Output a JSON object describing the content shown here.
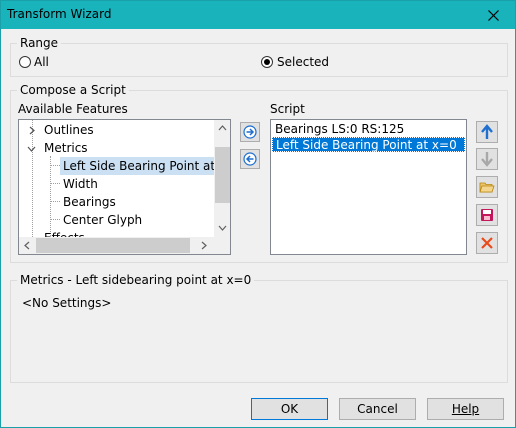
{
  "window": {
    "title": "Transform Wizard"
  },
  "range": {
    "label": "Range",
    "options": [
      {
        "label": "All",
        "selected": false
      },
      {
        "label": "Selected",
        "selected": true
      }
    ]
  },
  "compose": {
    "label": "Compose a Script",
    "available_label": "Available Features",
    "tree": [
      {
        "label": "Outlines",
        "expander": "collapsed"
      },
      {
        "label": "Metrics",
        "expander": "expanded"
      },
      {
        "label": "Left Side Bearing Point at x=",
        "selected": true
      },
      {
        "label": "Width"
      },
      {
        "label": "Bearings"
      },
      {
        "label": "Center Glyph"
      },
      {
        "label": "Effects"
      }
    ],
    "script_label": "Script",
    "script_items": [
      {
        "label": "Bearings LS:0 RS:125",
        "selected": false
      },
      {
        "label": "Left Side Bearing Point at x=0",
        "selected": true
      }
    ],
    "icons": {
      "add": "arrow-right-circle-icon",
      "remove": "arrow-left-circle-icon",
      "move_up": "arrow-up-icon",
      "move_down": "arrow-down-icon",
      "open": "open-folder-icon",
      "save": "save-icon",
      "delete": "delete-x-icon"
    }
  },
  "settings": {
    "label": "Metrics - Left sidebearing point at x=0",
    "value": "<No Settings>"
  },
  "buttons": {
    "ok": "OK",
    "cancel": "Cancel",
    "help": "Help"
  },
  "colors": {
    "titlebar": "#19b3bc",
    "selection": "#0078d7",
    "tree_selection": "#cce0f4",
    "arrow_blue": "#1e6fd0",
    "delete_red": "#e74c1a"
  }
}
